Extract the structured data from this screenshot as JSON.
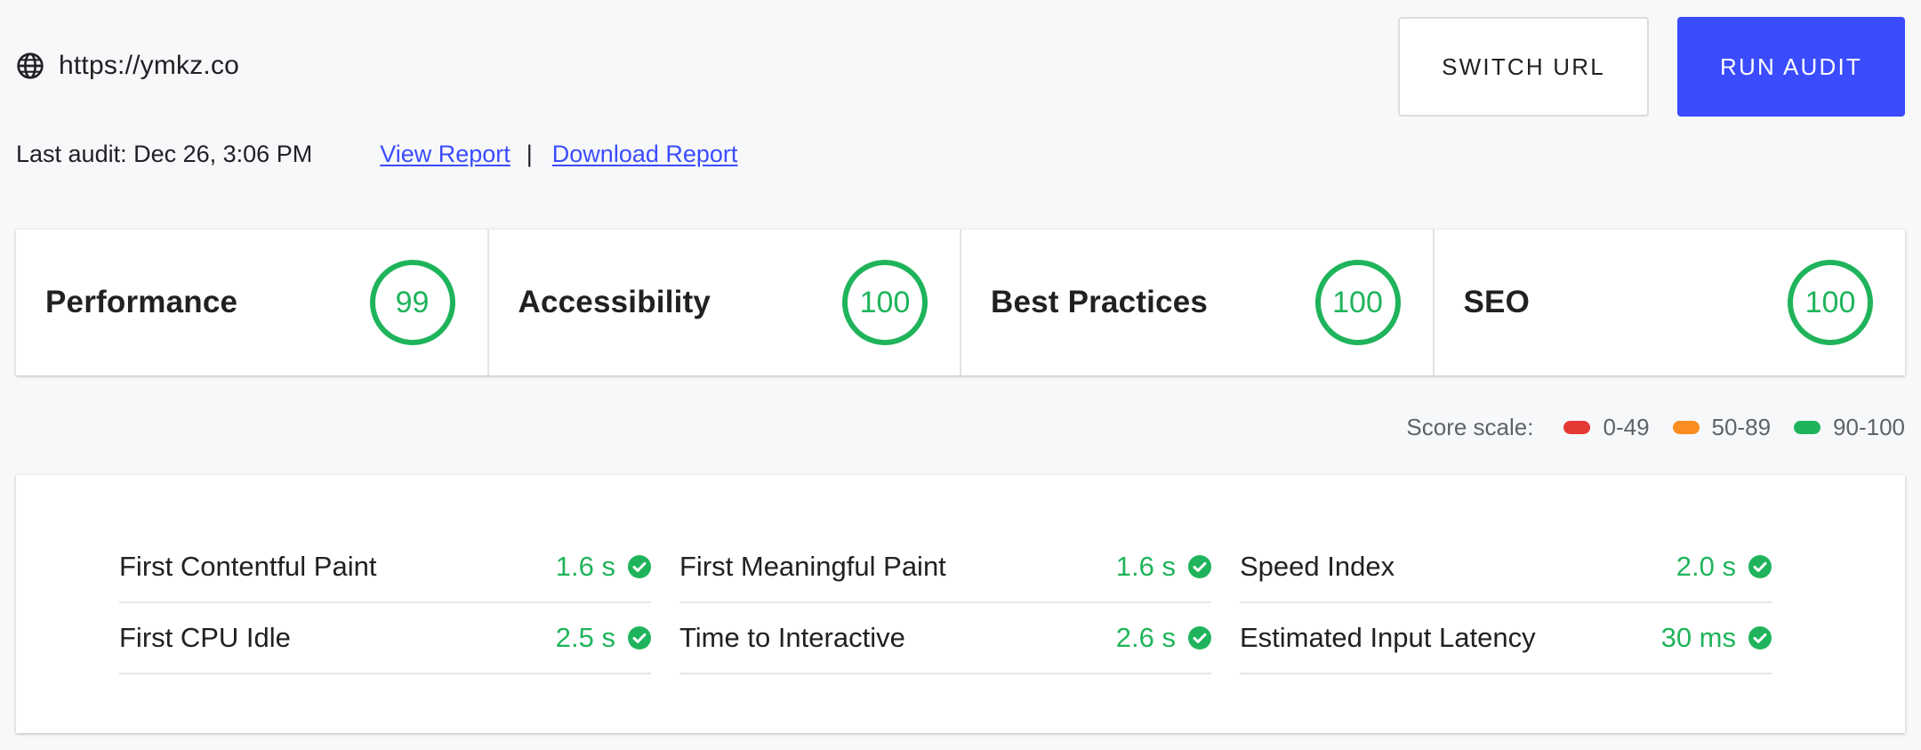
{
  "header": {
    "url": "https://ymkz.co",
    "switch_url_label": "SWITCH URL",
    "run_audit_label": "RUN AUDIT",
    "last_audit": "Last audit: Dec 26, 3:06 PM",
    "view_report": "View Report ",
    "separator": "|",
    "download_report": "Download Report"
  },
  "categories": [
    {
      "label": "Performance",
      "score": "99"
    },
    {
      "label": "Accessibility",
      "score": "100"
    },
    {
      "label": "Best Practices",
      "score": "100"
    },
    {
      "label": "SEO",
      "score": "100"
    }
  ],
  "score_scale": {
    "label": "Score scale:",
    "ranges": [
      {
        "label": "0-49",
        "color": "#e53935"
      },
      {
        "label": "50-89",
        "color": "#fb8c1f"
      },
      {
        "label": "90-100",
        "color": "#1fb45b"
      }
    ]
  },
  "metrics": [
    {
      "name": "First Contentful Paint",
      "value": "1.6 s"
    },
    {
      "name": "First Meaningful Paint",
      "value": "1.6 s"
    },
    {
      "name": "Speed Index",
      "value": "2.0 s"
    },
    {
      "name": "First CPU Idle",
      "value": "2.5 s"
    },
    {
      "name": "Time to Interactive",
      "value": "2.6 s"
    },
    {
      "name": "Estimated Input Latency",
      "value": "30 ms"
    }
  ],
  "colors": {
    "accent": "#3b4cff",
    "good": "#1fb45b"
  }
}
